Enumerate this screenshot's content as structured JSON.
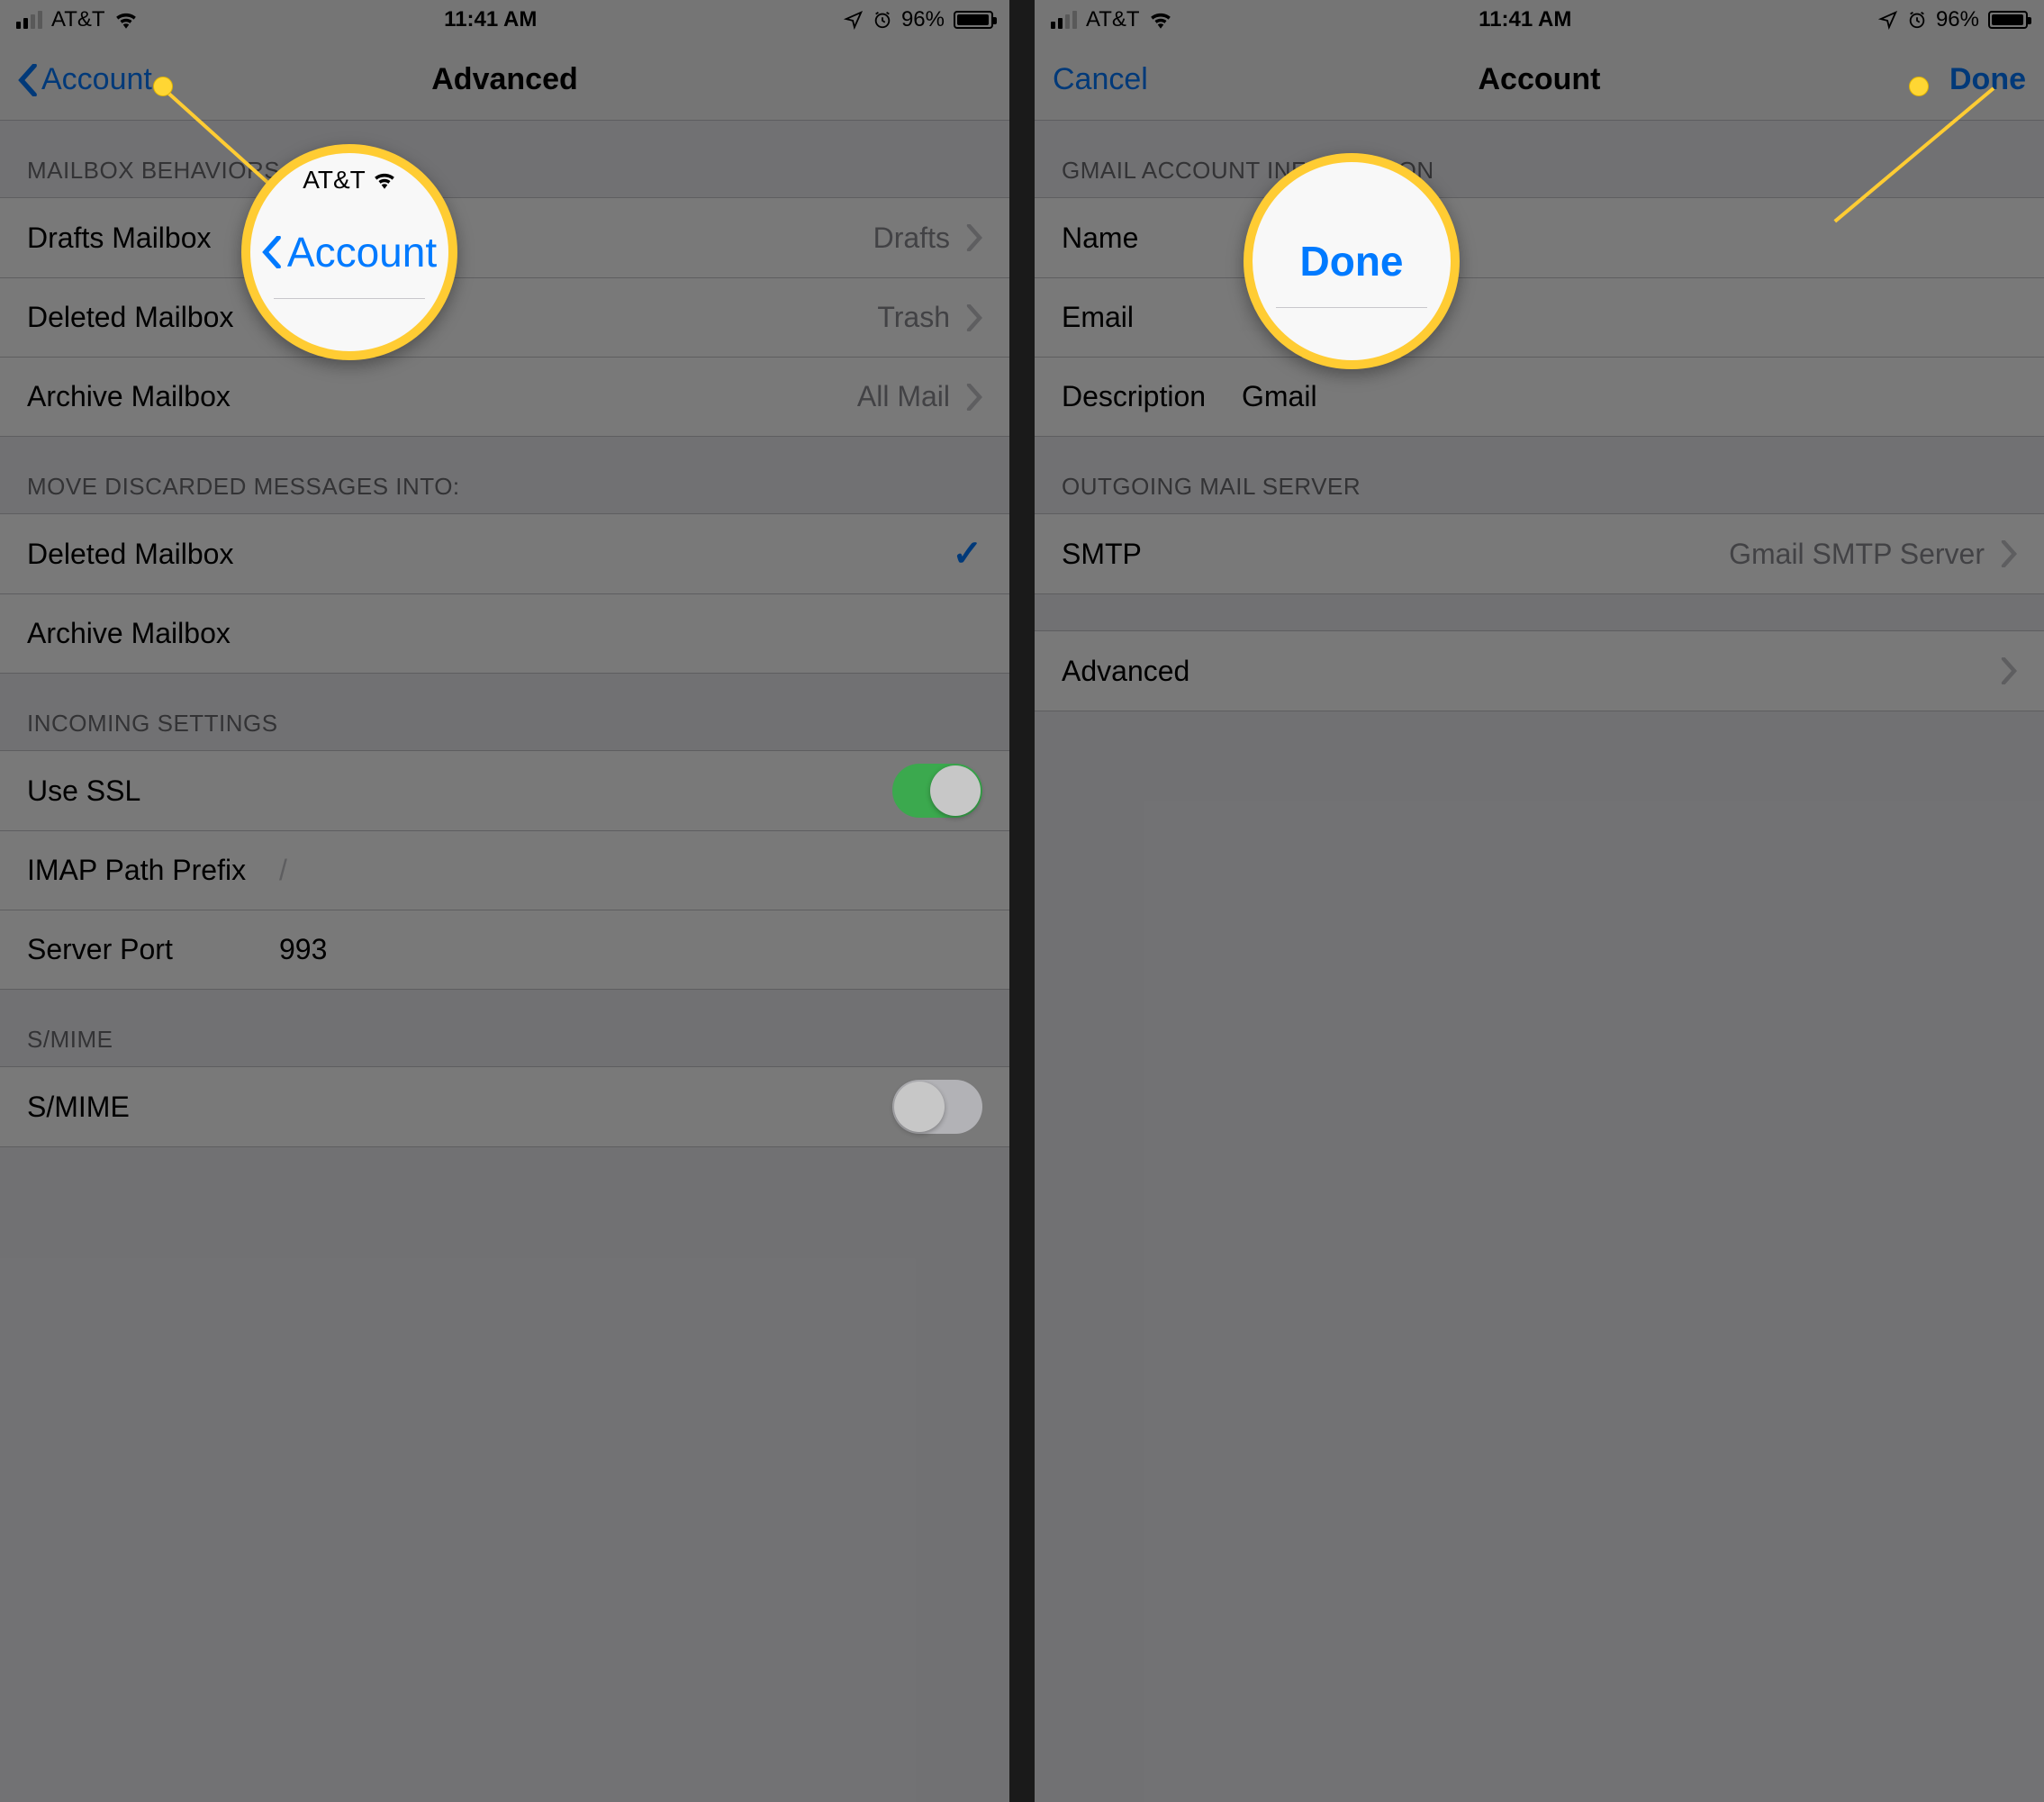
{
  "status_bar": {
    "carrier": "AT&T",
    "time": "11:41 AM",
    "battery_pct": "96%",
    "icons": {
      "location": "location-arrow-icon",
      "alarm": "alarm-clock-icon",
      "wifi": "wifi-icon",
      "signal": "cell-signal-icon",
      "battery": "battery-icon"
    }
  },
  "screens": {
    "left": {
      "nav": {
        "back_label": "Account",
        "title": "Advanced"
      },
      "sections": {
        "mailbox_behaviors": {
          "header": "MAILBOX BEHAVIORS",
          "rows": [
            {
              "label": "Drafts Mailbox",
              "value": "Drafts"
            },
            {
              "label": "Deleted Mailbox",
              "value": "Trash"
            },
            {
              "label": "Archive Mailbox",
              "value": "All Mail"
            }
          ]
        },
        "move_discarded": {
          "header": "MOVE DISCARDED MESSAGES INTO:",
          "rows": [
            {
              "label": "Deleted Mailbox",
              "checked": true
            },
            {
              "label": "Archive Mailbox",
              "checked": false
            }
          ]
        },
        "incoming": {
          "header": "INCOMING SETTINGS",
          "ssl_label": "Use SSL",
          "ssl_on": true,
          "imap_label": "IMAP Path Prefix",
          "imap_value": "/",
          "port_label": "Server Port",
          "port_value": "993"
        },
        "smime": {
          "header": "S/MIME",
          "label": "S/MIME",
          "on": false
        }
      },
      "callout": {
        "carrier": "AT&T",
        "main": "Account"
      }
    },
    "right": {
      "nav": {
        "cancel": "Cancel",
        "title": "Account",
        "done": "Done"
      },
      "sections": {
        "info": {
          "header": "GMAIL ACCOUNT INFORMATION",
          "name_label": "Name",
          "email_label": "Email",
          "desc_label": "Description",
          "desc_value": "Gmail"
        },
        "outgoing": {
          "header": "OUTGOING MAIL SERVER",
          "smtp_label": "SMTP",
          "smtp_value": "Gmail SMTP Server"
        },
        "advanced": {
          "label": "Advanced"
        }
      },
      "callout": {
        "main": "Done"
      }
    }
  },
  "colors": {
    "ios_blue": "#007aff",
    "ios_green": "#4cd964",
    "callout_yellow": "#ffcc33",
    "section_bg": "#efeff4"
  }
}
